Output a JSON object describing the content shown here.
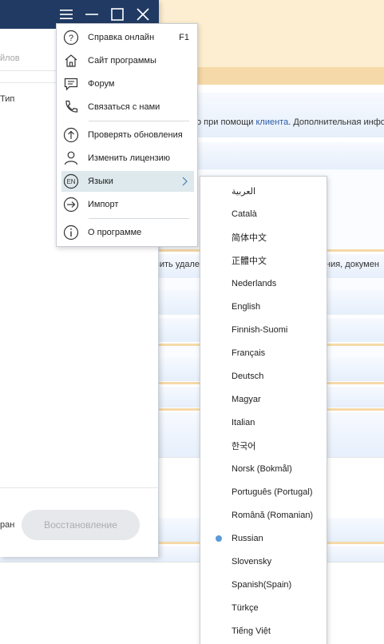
{
  "app": {
    "search": {
      "placeholder": "йлов"
    },
    "column_type": "Тип",
    "screen_label": "ран",
    "restore_button": "Восстановление"
  },
  "web": {
    "line1_prefix": "о при помощи ",
    "line1_link": "клиента",
    "line1_suffix": ". Дополнительная инфо",
    "line2_left": "вить удале",
    "line2_right": "ния, докумен"
  },
  "menu": {
    "items": [
      {
        "label": "Справка онлайн",
        "shortcut": "F1",
        "icon": "help-icon"
      },
      {
        "label": "Сайт программы",
        "icon": "home-icon"
      },
      {
        "label": "Форум",
        "icon": "forum-icon"
      },
      {
        "label": "Связаться с нами",
        "icon": "phone-icon"
      },
      {
        "label": "Проверять обновления",
        "icon": "update-icon"
      },
      {
        "label": "Изменить лицензию",
        "icon": "user-icon"
      },
      {
        "label": "Языки",
        "icon_text": "EN",
        "icon": "language-icon"
      },
      {
        "label": "Импорт",
        "icon": "import-icon"
      },
      {
        "label": "О программе",
        "icon": "info-icon"
      }
    ]
  },
  "languages": {
    "selected": "Russian",
    "items": [
      "العربية",
      "Català",
      "简体中文",
      "正體中文",
      "Nederlands",
      "English",
      "Finnish-Suomi",
      "Français",
      "Deutsch",
      "Magyar",
      "Italian",
      "한국어",
      "Norsk (Bokmål)",
      "Português (Portugal)",
      "Română (Romanian)",
      "Russian",
      "Slovensky",
      "Spanish(Spain)",
      "Türkçe",
      "Tiếng Việt"
    ]
  },
  "colors": {
    "titlebar": "#203a63",
    "active_item_bg": "#dde9ed",
    "selected_dot": "#5b9bd8",
    "link": "#2a5caa"
  }
}
